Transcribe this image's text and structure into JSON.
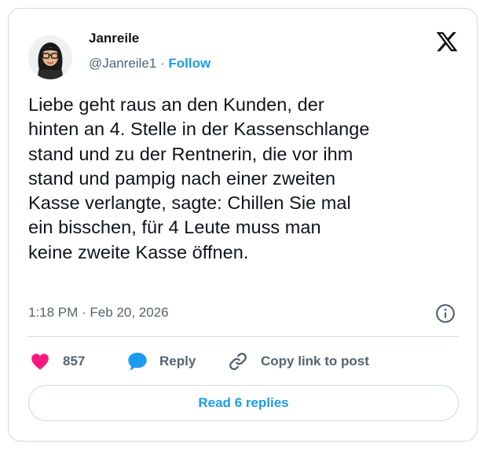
{
  "user": {
    "name": "Janreile",
    "handle": "@Janreile1",
    "separator": " · ",
    "follow_label": "Follow"
  },
  "tweet": {
    "text": "Liebe geht raus an den Kunden, der\nhinten an 4. Stelle in der Kassenschlange\nstand und zu der Rentnerin, die vor ihm\nstand und pampig nach einer zweiten\nKasse verlangte, sagte: Chillen Sie mal\nein bisschen, für 4 Leute muss man\nkeine zweite Kasse öffnen.",
    "time": "1:18 PM",
    "date_separator": " · ",
    "date": "Feb 20, 2026"
  },
  "actions": {
    "likes": "857",
    "reply_label": "Reply",
    "copy_label": "Copy link to post"
  },
  "read_replies_label": "Read 6 replies",
  "icons": {
    "brand": "x-logo-icon",
    "info": "info-icon",
    "like": "heart-icon",
    "reply": "speech-bubble-icon",
    "copy": "link-icon"
  },
  "colors": {
    "accent": "#1d9bf0",
    "like": "#f91880",
    "text": "#0f1419",
    "muted": "#536471",
    "border": "#cfd9de"
  }
}
